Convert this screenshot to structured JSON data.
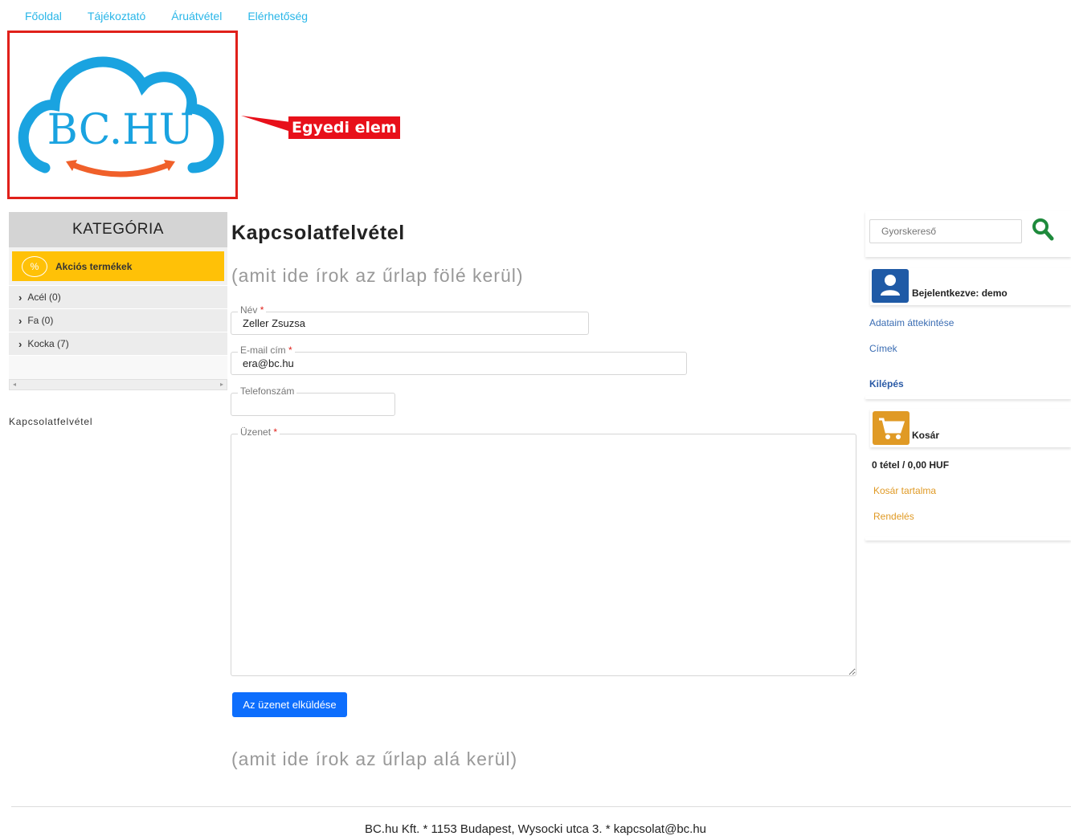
{
  "nav": {
    "items": [
      "Főoldal",
      "Tájékoztató",
      "Áruátvétel",
      "Elérhetőség"
    ]
  },
  "logo": {
    "text": "BC.HU",
    "colors": {
      "cloud": "#1aa3e0",
      "text": "#1aa3e0",
      "arrow": "#f0602a"
    }
  },
  "callout": {
    "label": "Egyedi elem",
    "color": "#e8101a"
  },
  "sidebar": {
    "heading": "KATEGÓRIA",
    "promo": {
      "icon": "percent-icon",
      "symbol": "%",
      "label": "Akciós termékek",
      "color": "#ffc107"
    },
    "categories": [
      {
        "label": "Acél (0)"
      },
      {
        "label": "Fa (0)"
      },
      {
        "label": "Kocka (7)"
      }
    ],
    "breadcrumb": "Kapcsolatfelvétel"
  },
  "main": {
    "title": "Kapcsolatfelvétel",
    "above_form": "(amit ide írok az űrlap fölé kerül)",
    "below_form": "(amit ide írok az űrlap alá kerül)",
    "form": {
      "name": {
        "label": "Név",
        "required": "*",
        "value": "Zeller Zsuzsa"
      },
      "email": {
        "label": "E-mail cím",
        "required": "*",
        "value": "era@bc.hu"
      },
      "phone": {
        "label": "Telefonszám",
        "value": ""
      },
      "message": {
        "label": "Üzenet",
        "required": "*",
        "value": ""
      },
      "submit": "Az üzenet elküldése",
      "submit_color": "#0d6efd"
    }
  },
  "right": {
    "search": {
      "placeholder": "Gyorskereső",
      "icon": "search-icon",
      "icon_color": "#1e8a3c"
    },
    "user": {
      "icon": "user-icon",
      "title": "Bejelentkezve: demo",
      "links": [
        "Adataim áttekintése",
        "Címek"
      ],
      "logout": "Kilépés"
    },
    "cart": {
      "icon": "cart-icon",
      "title": "Kosár",
      "summary": "0 tétel / 0,00 HUF",
      "links": [
        "Kosár tartalma",
        "Rendelés"
      ]
    }
  },
  "footer": {
    "text": "BC.hu Kft. * 1153 Budapest, Wysocki utca 3. * kapcsolat@bc.hu"
  }
}
